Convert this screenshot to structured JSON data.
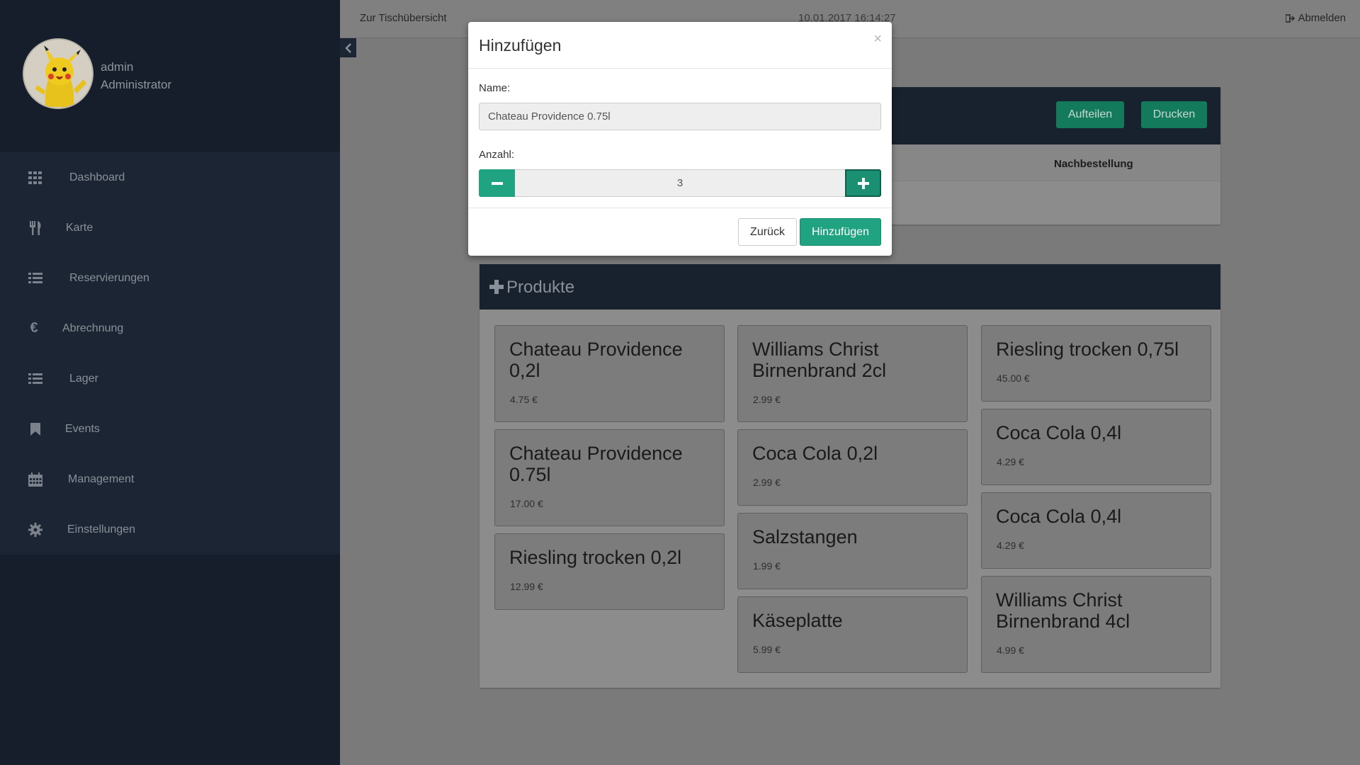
{
  "user": {
    "name": "admin",
    "role": "Administrator"
  },
  "sidebar": {
    "items": [
      {
        "label": "Dashboard",
        "icon": "grid-icon"
      },
      {
        "label": "Karte",
        "icon": "utensils-icon"
      },
      {
        "label": "Reservierungen",
        "icon": "list-icon"
      },
      {
        "label": "Abrechnung",
        "icon": "euro-icon"
      },
      {
        "label": "Lager",
        "icon": "list-icon"
      },
      {
        "label": "Events",
        "icon": "bookmark-icon"
      },
      {
        "label": "Management",
        "icon": "calendar-icon"
      },
      {
        "label": "Einstellungen",
        "icon": "gear-icon"
      }
    ]
  },
  "topbar": {
    "back_link": "Zur Tischübersicht",
    "datetime": "10.01.2017 16:14:27",
    "logout": "Abmelden"
  },
  "order": {
    "split_label": "Aufteilen",
    "print_label": "Drucken",
    "column_reorder": "Nachbestellung"
  },
  "products": {
    "title": "Produkte",
    "items": [
      {
        "name": "Chateau Providence 0,2l",
        "price": "4.75 €"
      },
      {
        "name": "Chateau Providence 0.75l",
        "price": "17.00 €"
      },
      {
        "name": "Riesling trocken 0,2l",
        "price": "12.99 €"
      },
      {
        "name": "Williams Christ Birnenbrand 2cl",
        "price": "2.99 €"
      },
      {
        "name": "Coca Cola 0,2l",
        "price": "2.99 €"
      },
      {
        "name": "Salzstangen",
        "price": "1.99 €"
      },
      {
        "name": "Käseplatte",
        "price": "5.99 €"
      },
      {
        "name": "Riesling trocken 0,75l",
        "price": "45.00 €"
      },
      {
        "name": "Coca Cola 0,4l",
        "price": "4.29 €"
      },
      {
        "name": "Coca Cola 0,4l",
        "price": "4.29 €"
      },
      {
        "name": "Williams Christ Birnenbrand 4cl",
        "price": "4.99 €"
      }
    ]
  },
  "modal": {
    "title": "Hinzufügen",
    "close": "×",
    "name_label": "Name:",
    "name_value": "Chateau Providence 0.75l",
    "qty_label": "Anzahl:",
    "qty_value": "3",
    "back_label": "Zurück",
    "add_label": "Hinzufügen"
  },
  "colors": {
    "sidebar_bg": "#151e2a",
    "accent_green": "#1fa381",
    "dark_green": "#147a5c",
    "overlay_grey": "#7a7a7a"
  }
}
